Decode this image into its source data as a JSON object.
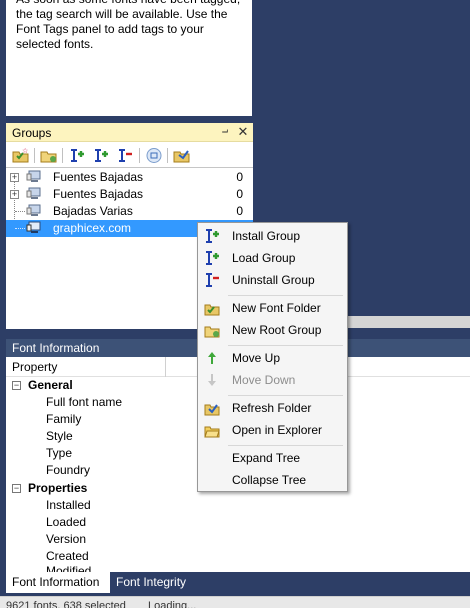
{
  "tag_panel": {
    "text": "As soon as some fonts have been tagged,\nthe tag search will be available. Use the\nFont Tags panel to add tags to your\nselected fonts."
  },
  "groups_panel": {
    "title": "Groups",
    "pin_glyph": "⨼",
    "close_glyph": "✕",
    "toolbar": [
      "add-group-icon",
      "new-folder-icon",
      "install-group-icon",
      "load-group-icon",
      "uninstall-group-icon",
      "sync-icon",
      "refresh-folder-icon"
    ],
    "items": [
      {
        "label": "Fuentes Bajadas",
        "count": "0",
        "expandable": true
      },
      {
        "label": "Fuentes Bajadas",
        "count": "0",
        "expandable": true
      },
      {
        "label": "Bajadas Varias",
        "count": "0",
        "expandable": false
      },
      {
        "label": "graphicex.com",
        "count": "",
        "expandable": false,
        "selected": true
      }
    ]
  },
  "context_menu": {
    "items": [
      {
        "label": "Install Group",
        "icon": "install-group-icon",
        "enabled": true
      },
      {
        "label": "Load Group",
        "icon": "load-group-icon",
        "enabled": true
      },
      {
        "label": "Uninstall Group",
        "icon": "uninstall-group-icon",
        "enabled": true
      },
      {
        "label": "New Font Folder",
        "icon": "new-font-folder-icon",
        "enabled": true
      },
      {
        "label": "New Root Group",
        "icon": "new-root-group-icon",
        "enabled": true
      },
      {
        "label": "Move Up",
        "icon": "arrow-up-icon",
        "enabled": true
      },
      {
        "label": "Move Down",
        "icon": "arrow-down-icon",
        "enabled": false
      },
      {
        "label": "Refresh Folder",
        "icon": "refresh-folder-icon",
        "enabled": true
      },
      {
        "label": "Open in Explorer",
        "icon": "open-folder-icon",
        "enabled": true
      },
      {
        "label": "Expand Tree",
        "icon": "",
        "enabled": true
      },
      {
        "label": "Collapse Tree",
        "icon": "",
        "enabled": true
      }
    ]
  },
  "font_info": {
    "title": "Font Information",
    "column_header": "Property",
    "categories": [
      {
        "name": "General",
        "props": [
          "Full font name",
          "Family",
          "Style",
          "Type",
          "Foundry"
        ]
      },
      {
        "name": "Properties",
        "props": [
          "Installed",
          "Loaded",
          "Version",
          "Created",
          "Modified"
        ]
      }
    ]
  },
  "bottom_tabs": [
    {
      "label": "Font Information",
      "active": true
    },
    {
      "label": "Font Integrity",
      "active": false
    }
  ],
  "status_bar": {
    "left": "9621 fonts, 638 selected",
    "right": "Loading..."
  },
  "colors": {
    "selection": "#3399ff",
    "panel_header": "#fdf4bf",
    "frame": "#2d3e66",
    "section_header": "#3d5277"
  }
}
